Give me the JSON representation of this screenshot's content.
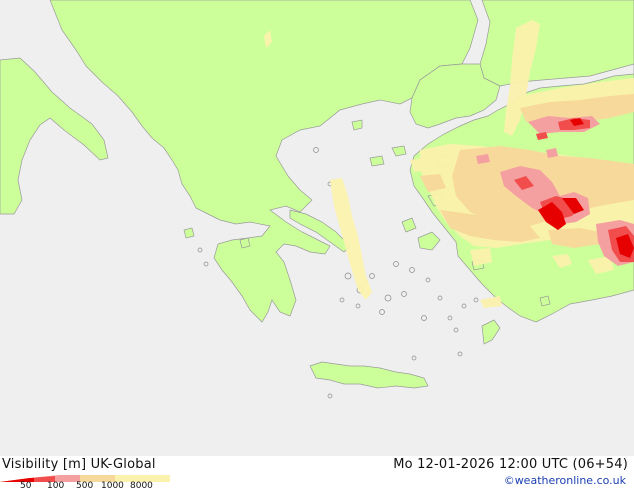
{
  "footer": {
    "variable": "Visibility [m]",
    "model": "UK-Global",
    "datetime": "Mo 12-01-2026 12:00 UTC (06+54)",
    "credit": "©weatheronline.co.uk"
  },
  "legend": {
    "stops": [
      "50",
      "100",
      "500",
      "1000",
      "8000"
    ],
    "colors": [
      "#e60000",
      "#f24d4d",
      "#f5a0a0",
      "#f7d99c",
      "#fbf2ad"
    ]
  },
  "map": {
    "sea_color": "#efefef",
    "land_color": "#ccff99",
    "low_vis_colors": {
      "light": "#fbf2ad",
      "moderate": "#f7d99c",
      "poor": "#f5a0a0",
      "very_poor": "#f24d4d",
      "fog": "#e60000"
    }
  }
}
